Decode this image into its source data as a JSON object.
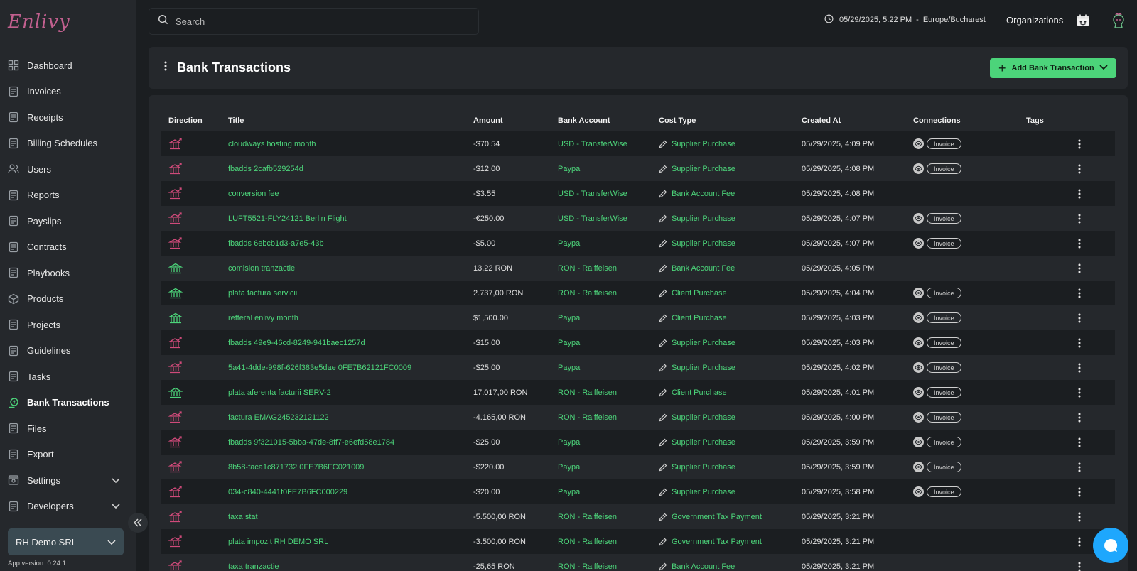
{
  "brand": {
    "logo_text": "Enlivy"
  },
  "sidebar": {
    "items": [
      {
        "label": "Dashboard",
        "icon": "dashboard-icon"
      },
      {
        "label": "Invoices",
        "icon": "invoice-icon"
      },
      {
        "label": "Receipts",
        "icon": "receipt-icon"
      },
      {
        "label": "Billing Schedules",
        "icon": "calendar-icon"
      },
      {
        "label": "Users",
        "icon": "users-icon"
      },
      {
        "label": "Reports",
        "icon": "report-icon"
      },
      {
        "label": "Payslips",
        "icon": "payslip-icon"
      },
      {
        "label": "Contracts",
        "icon": "contract-icon"
      },
      {
        "label": "Playbooks",
        "icon": "playbook-icon"
      },
      {
        "label": "Products",
        "icon": "box-icon"
      },
      {
        "label": "Projects",
        "icon": "project-icon"
      },
      {
        "label": "Guidelines",
        "icon": "guideline-icon"
      },
      {
        "label": "Tasks",
        "icon": "task-icon"
      },
      {
        "label": "Bank Transactions",
        "icon": "bank-transaction-icon",
        "active": true
      },
      {
        "label": "Files",
        "icon": "file-icon"
      },
      {
        "label": "Export",
        "icon": "export-icon"
      },
      {
        "label": "Settings",
        "icon": "settings-icon",
        "expandable": true
      },
      {
        "label": "Developers",
        "icon": "developer-icon",
        "expandable": true
      }
    ],
    "org_select": "RH Demo SRL",
    "app_version": "App version: 0.24.1"
  },
  "topbar": {
    "search_placeholder": "Search",
    "datetime": "05/29/2025, 5:22 PM",
    "separator": "-",
    "timezone": "Europe/Bucharest",
    "organizations_label": "Organizations"
  },
  "header": {
    "title": "Bank Transactions",
    "add_button_label": "Add Bank Transaction"
  },
  "colors": {
    "accent": "#4cd47a",
    "outgoing": "#d04a7a",
    "incoming": "#4cd47a",
    "chat": "#1ea7fd"
  },
  "table": {
    "columns": [
      "Direction",
      "Title",
      "Amount",
      "Bank Account",
      "Cost Type",
      "Created At",
      "Connections",
      "Tags"
    ],
    "rows": [
      {
        "direction": "out",
        "title": "cloudways hosting month",
        "amount": "-$70.54",
        "bank": "USD - TransferWise",
        "cost_type": "Supplier Purchase",
        "created": "05/29/2025, 4:09 PM",
        "connection": "Invoice"
      },
      {
        "direction": "out",
        "title": "fbadds 2cafb529254d",
        "amount": "-$12.00",
        "bank": "Paypal",
        "cost_type": "Supplier Purchase",
        "created": "05/29/2025, 4:08 PM",
        "connection": "Invoice"
      },
      {
        "direction": "out",
        "title": "conversion fee",
        "amount": "-$3.55",
        "bank": "USD - TransferWise",
        "cost_type": "Bank Account Fee",
        "created": "05/29/2025, 4:08 PM",
        "connection": ""
      },
      {
        "direction": "out",
        "title": "LUFT5521-FLY24121 Berlin Flight",
        "amount": "-€250.00",
        "bank": "USD - TransferWise",
        "cost_type": "Supplier Purchase",
        "created": "05/29/2025, 4:07 PM",
        "connection": "Invoice"
      },
      {
        "direction": "out",
        "title": "fbadds 6ebcb1d3-a7e5-43b",
        "amount": "-$5.00",
        "bank": "Paypal",
        "cost_type": "Supplier Purchase",
        "created": "05/29/2025, 4:07 PM",
        "connection": "Invoice"
      },
      {
        "direction": "in",
        "title": "comision tranzactie",
        "amount": "13,22 RON",
        "bank": "RON - Raiffeisen",
        "cost_type": "Bank Account Fee",
        "created": "05/29/2025, 4:05 PM",
        "connection": ""
      },
      {
        "direction": "in",
        "title": "plata factura servicii",
        "amount": "2.737,00 RON",
        "bank": "RON - Raiffeisen",
        "cost_type": "Client Purchase",
        "created": "05/29/2025, 4:04 PM",
        "connection": "Invoice"
      },
      {
        "direction": "in",
        "title": "refferal enlivy month",
        "amount": "$1,500.00",
        "bank": "Paypal",
        "cost_type": "Client Purchase",
        "created": "05/29/2025, 4:03 PM",
        "connection": "Invoice"
      },
      {
        "direction": "out",
        "title": "fbadds 49e9-46cd-8249-941baec1257d",
        "amount": "-$15.00",
        "bank": "Paypal",
        "cost_type": "Supplier Purchase",
        "created": "05/29/2025, 4:03 PM",
        "connection": "Invoice"
      },
      {
        "direction": "out",
        "title": "5a41-4dde-998f-626f383e5dae 0FE7B62121FC0009",
        "amount": "-$25.00",
        "bank": "Paypal",
        "cost_type": "Supplier Purchase",
        "created": "05/29/2025, 4:02 PM",
        "connection": "Invoice"
      },
      {
        "direction": "in",
        "title": "plata aferenta facturii SERV-2",
        "amount": "17.017,00 RON",
        "bank": "RON - Raiffeisen",
        "cost_type": "Client Purchase",
        "created": "05/29/2025, 4:01 PM",
        "connection": "Invoice"
      },
      {
        "direction": "out",
        "title": "factura EMAG245232121122",
        "amount": "-4.165,00 RON",
        "bank": "RON - Raiffeisen",
        "cost_type": "Supplier Purchase",
        "created": "05/29/2025, 4:00 PM",
        "connection": "Invoice"
      },
      {
        "direction": "out",
        "title": "fbadds 9f321015-5bba-47de-8ff7-e6efd58e1784",
        "amount": "-$25.00",
        "bank": "Paypal",
        "cost_type": "Supplier Purchase",
        "created": "05/29/2025, 3:59 PM",
        "connection": "Invoice"
      },
      {
        "direction": "out",
        "title": "8b58-faca1c871732 0FE7B6FC021009",
        "amount": "-$220.00",
        "bank": "Paypal",
        "cost_type": "Supplier Purchase",
        "created": "05/29/2025, 3:59 PM",
        "connection": "Invoice"
      },
      {
        "direction": "out",
        "title": "034-c840-4441f0FE7B6FC000229",
        "amount": "-$20.00",
        "bank": "Paypal",
        "cost_type": "Supplier Purchase",
        "created": "05/29/2025, 3:58 PM",
        "connection": "Invoice"
      },
      {
        "direction": "out",
        "title": "taxa stat",
        "amount": "-5.500,00 RON",
        "bank": "RON - Raiffeisen",
        "cost_type": "Government Tax Payment",
        "created": "05/29/2025, 3:21 PM",
        "connection": ""
      },
      {
        "direction": "out",
        "title": "plata impozit RH DEMO SRL",
        "amount": "-3.500,00 RON",
        "bank": "RON - Raiffeisen",
        "cost_type": "Government Tax Payment",
        "created": "05/29/2025, 3:21 PM",
        "connection": ""
      },
      {
        "direction": "out",
        "title": "taxa tranzactie",
        "amount": "-25,65 RON",
        "bank": "RON - Raiffeisen",
        "cost_type": "Bank Account Fee",
        "created": "05/29/2025, 3:21 PM",
        "connection": ""
      }
    ]
  }
}
